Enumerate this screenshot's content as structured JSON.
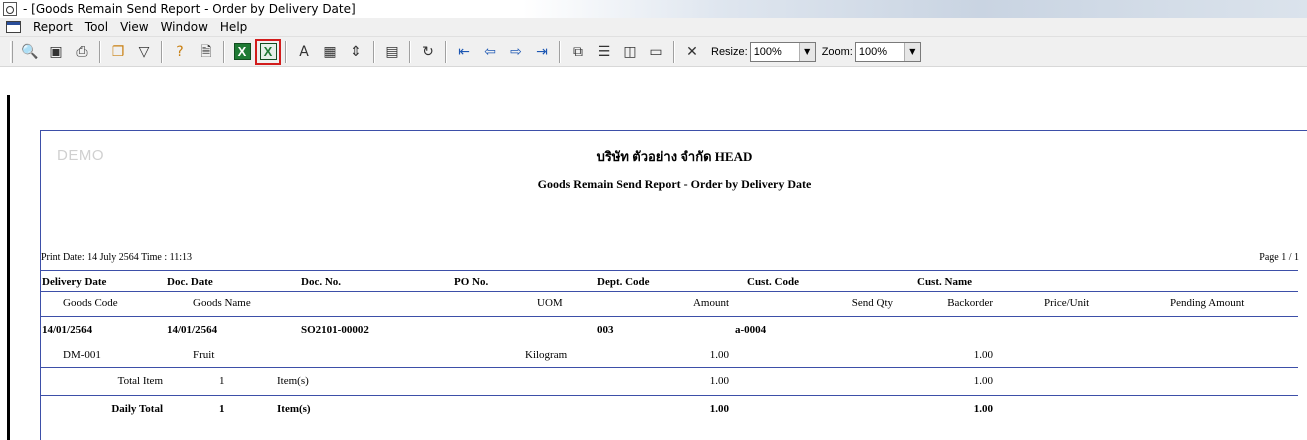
{
  "window": {
    "title": "- [Goods Remain Send Report - Order by Delivery Date]"
  },
  "menu": {
    "items": [
      "Report",
      "Tool",
      "View",
      "Window",
      "Help"
    ]
  },
  "toolbar": {
    "icons": [
      "preview-icon",
      "print-setup-icon",
      "print-icon",
      "copy-icon",
      "filter-icon",
      "help-icon",
      "export-icon",
      "excel-icon",
      "excel-export-icon",
      "font-icon",
      "grid-icon",
      "fit-icon",
      "calculator-icon",
      "refresh-icon",
      "first-page-icon",
      "prev-page-icon",
      "next-page-icon",
      "last-page-icon",
      "multi-page-icon",
      "single-row-icon",
      "two-column-icon",
      "full-page-icon",
      "close-icon"
    ],
    "resize_label": "Resize:",
    "resize_value": "100%",
    "zoom_label": "Zoom:",
    "zoom_value": "100%"
  },
  "report": {
    "watermark": "DEMO",
    "company": "บริษัท ตัวอย่าง จำกัด   HEAD",
    "title": "Goods Remain Send Report - Order by Delivery Date",
    "print_date": "Print Date: 14 July 2564  Time : 11:13",
    "page": "Page 1 / 1",
    "header1": {
      "delivery_date": "Delivery Date",
      "doc_date": "Doc. Date",
      "doc_no": "Doc. No.",
      "po_no": "PO No.",
      "dept_code": "Dept. Code",
      "cust_code": "Cust. Code",
      "cust_name": "Cust. Name"
    },
    "header2": {
      "goods_code": "Goods Code",
      "goods_name": "Goods Name",
      "uom": "UOM",
      "amount": "Amount",
      "send_qty": "Send Qty",
      "backorder": "Backorder",
      "price_unit": "Price/Unit",
      "pending_amount": "Pending Amount"
    },
    "group": {
      "delivery_date": "14/01/2564",
      "doc_date": "14/01/2564",
      "doc_no": "SO2101-00002",
      "dept_code": "003",
      "cust_code": "a-0004"
    },
    "detail": {
      "goods_code": "DM-001",
      "goods_name": "Fruit",
      "uom": "Kilogram",
      "amount": "1.00",
      "backorder": "1.00"
    },
    "total_item": {
      "label": "Total Item",
      "count": "1",
      "unit": "Item(s)",
      "amount": "1.00",
      "backorder": "1.00"
    },
    "daily_total": {
      "label": "Daily Total",
      "count": "1",
      "unit": "Item(s)",
      "amount": "1.00",
      "backorder": "1.00"
    }
  }
}
